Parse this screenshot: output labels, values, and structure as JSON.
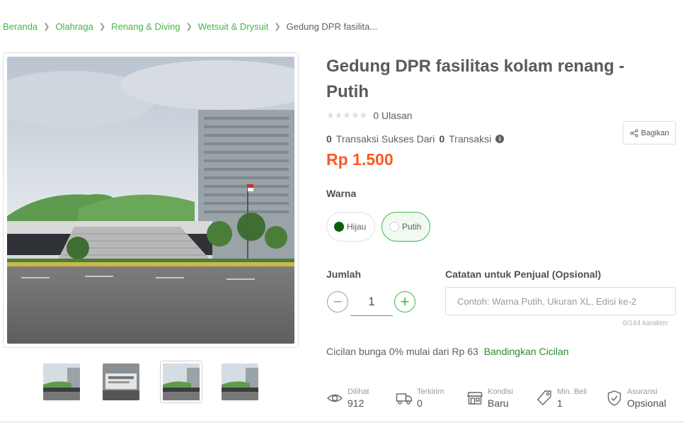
{
  "breadcrumb": {
    "items": [
      "Beranda",
      "Olahraga",
      "Renang & Diving",
      "Wetsuit & Drysuit"
    ],
    "current": "Gedung DPR fasilita..."
  },
  "product": {
    "title": "Gedung DPR fasilitas kolam renang - Putih",
    "rating_stars": 0,
    "reviews": "0 Ulasan",
    "tx_success": "0",
    "tx_success_label": "Transaksi Sukses Dari",
    "tx_total": "0",
    "tx_total_label": "Transaksi",
    "price": "Rp 1.500"
  },
  "share": {
    "label": "Bagikan"
  },
  "variant": {
    "label": "Warna",
    "options": [
      {
        "label": "Hijau",
        "color": "#0b5e0b",
        "selected": false
      },
      {
        "label": "Putih",
        "color": "#ffffff",
        "selected": true
      }
    ]
  },
  "quantity": {
    "label": "Jumlah",
    "value": "1"
  },
  "note": {
    "label": "Catatan untuk Penjual (Opsional)",
    "placeholder": "Contoh: Warna Putih, Ukuran XL, Edisi ke-2",
    "counter": "0/144 karakter"
  },
  "installment": {
    "text": "Cicilan bunga 0% mulai dari Rp 63",
    "link": "Bandingkan Cicilan"
  },
  "stats": [
    {
      "icon": "eye-icon",
      "label": "Dilihat",
      "value": "912"
    },
    {
      "icon": "truck-icon",
      "label": "Terkirim",
      "value": "0"
    },
    {
      "icon": "store-icon",
      "label": "Kondisi",
      "value": "Baru"
    },
    {
      "icon": "tag-icon",
      "label": "Min. Beli",
      "value": "1"
    },
    {
      "icon": "shield-icon",
      "label": "Asuransi",
      "value": "Opsional"
    }
  ],
  "colors": {
    "accent": "#42b549",
    "price": "#ff5722",
    "link_dark": "#2a8a2f"
  }
}
